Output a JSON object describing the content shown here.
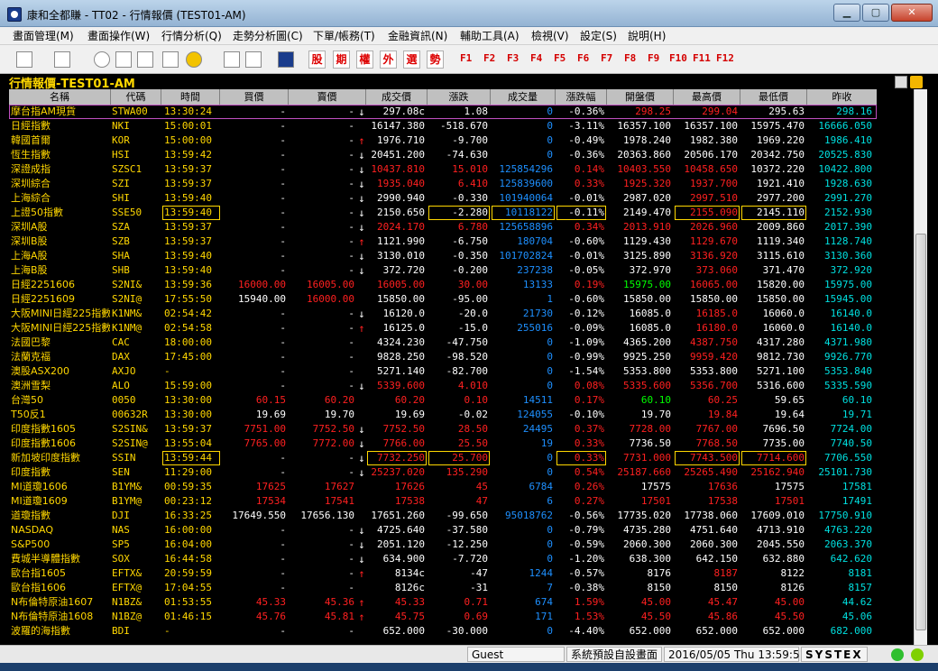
{
  "window": {
    "title": "康和全都賺 - TT02 - 行情報價 (TEST01-AM)"
  },
  "menu": [
    "畫面管理(M)",
    "畫面操作(W)",
    "行情分析(Q)",
    "走勢分析圖(C)",
    "下單/帳務(T)",
    "金融資訊(N)",
    "輔助工具(A)",
    "檢視(V)",
    "設定(S)",
    "說明(H)"
  ],
  "toolbar": {
    "cn_buttons": [
      "股",
      "期",
      "權",
      "外",
      "選",
      "勢"
    ],
    "fkeys": [
      "F1",
      "F2",
      "F3",
      "F4",
      "F5",
      "F6",
      "F7",
      "F8",
      "F9",
      "F10",
      "F11",
      "F12"
    ]
  },
  "panel_title": "行情報價-TEST01-AM",
  "columns": [
    "名稱",
    "代碼",
    "時間",
    "買價",
    "賣價",
    "成交價",
    "漲跌",
    "成交量",
    "漲跌幅",
    "開盤價",
    "最高價",
    "最低價",
    "昨收"
  ],
  "rows": [
    [
      "摩台指AM現貨",
      "STWA00",
      "13:30:24",
      "-",
      "-",
      "↓",
      "297.08c",
      "1.08",
      "0",
      "-0.36%",
      "298.25",
      "299.04",
      "295.63",
      "298.16"
    ],
    [
      "日經指數",
      "NKI",
      "15:00:01",
      "-",
      "-",
      "",
      "16147.380",
      "-518.670",
      "0",
      "-3.11%",
      "16357.100",
      "16357.100",
      "15975.470",
      "16666.050"
    ],
    [
      "韓國首爾",
      "KOR",
      "15:00:00",
      "-",
      "-",
      "↑",
      "1976.710",
      "-9.700",
      "0",
      "-0.49%",
      "1978.240",
      "1982.380",
      "1969.220",
      "1986.410"
    ],
    [
      "恆生指數",
      "HSI",
      "13:59:42",
      "-",
      "-",
      "↓",
      "20451.200",
      "-74.630",
      "0",
      "-0.36%",
      "20363.860",
      "20506.170",
      "20342.750",
      "20525.830"
    ],
    [
      "深證成指",
      "SZSC1",
      "13:59:37",
      "-",
      "-",
      "↓",
      "10437.810",
      "15.010",
      "125854296",
      "0.14%",
      "10403.550",
      "10458.650",
      "10372.220",
      "10422.800"
    ],
    [
      "深圳綜合",
      "SZI",
      "13:59:37",
      "-",
      "-",
      "↓",
      "1935.040",
      "6.410",
      "125839600",
      "0.33%",
      "1925.320",
      "1937.700",
      "1921.410",
      "1928.630"
    ],
    [
      "上海綜合",
      "SHI",
      "13:59:40",
      "-",
      "-",
      "↓",
      "2990.940",
      "-0.330",
      "101940064",
      "-0.01%",
      "2987.020",
      "2997.510",
      "2977.200",
      "2991.270"
    ],
    [
      "上證50指數",
      "SSE50",
      "13:59:40",
      "-",
      "-",
      "↓",
      "2150.650",
      "-2.280",
      "10118122",
      "-0.11%",
      "2149.470",
      "2155.090",
      "2145.110",
      "2152.930"
    ],
    [
      "深圳A股",
      "SZA",
      "13:59:37",
      "-",
      "-",
      "↓",
      "2024.170",
      "6.780",
      "125658896",
      "0.34%",
      "2013.910",
      "2026.960",
      "2009.860",
      "2017.390"
    ],
    [
      "深圳B股",
      "SZB",
      "13:59:37",
      "-",
      "-",
      "↑",
      "1121.990",
      "-6.750",
      "180704",
      "-0.60%",
      "1129.430",
      "1129.670",
      "1119.340",
      "1128.740"
    ],
    [
      "上海A股",
      "SHA",
      "13:59:40",
      "-",
      "-",
      "↓",
      "3130.010",
      "-0.350",
      "101702824",
      "-0.01%",
      "3125.890",
      "3136.920",
      "3115.610",
      "3130.360"
    ],
    [
      "上海B股",
      "SHB",
      "13:59:40",
      "-",
      "-",
      "↓",
      "372.720",
      "-0.200",
      "237238",
      "-0.05%",
      "372.970",
      "373.060",
      "371.470",
      "372.920"
    ],
    [
      "日經2251606",
      "S2NI&",
      "13:59:36",
      "16000.00",
      "16005.00",
      "",
      "16005.00",
      "30.00",
      "13133",
      "0.19%",
      "15975.00",
      "16065.00",
      "15820.00",
      "15975.00"
    ],
    [
      "日經2251609",
      "S2NI@",
      "17:55:50",
      "15940.00",
      "16000.00",
      "",
      "15850.00",
      "-95.00",
      "1",
      "-0.60%",
      "15850.00",
      "15850.00",
      "15850.00",
      "15945.00"
    ],
    [
      "大阪MINI日經225指數",
      "K1NM&",
      "02:54:42",
      "-",
      "-",
      "↓",
      "16120.0",
      "-20.0",
      "21730",
      "-0.12%",
      "16085.0",
      "16185.0",
      "16060.0",
      "16140.0"
    ],
    [
      "大阪MINI日經225指數",
      "K1NM@",
      "02:54:58",
      "-",
      "-",
      "↑",
      "16125.0",
      "-15.0",
      "255016",
      "-0.09%",
      "16085.0",
      "16180.0",
      "16060.0",
      "16140.0"
    ],
    [
      "法國巴黎",
      "CAC",
      "18:00:00",
      "-",
      "-",
      "",
      "4324.230",
      "-47.750",
      "0",
      "-1.09%",
      "4365.200",
      "4387.750",
      "4317.280",
      "4371.980"
    ],
    [
      "法蘭克福",
      "DAX",
      "17:45:00",
      "-",
      "-",
      "",
      "9828.250",
      "-98.520",
      "0",
      "-0.99%",
      "9925.250",
      "9959.420",
      "9812.730",
      "9926.770"
    ],
    [
      "澳股ASX200",
      "AXJO",
      "-",
      "-",
      "-",
      "",
      "5271.140",
      "-82.700",
      "0",
      "-1.54%",
      "5353.800",
      "5353.800",
      "5271.100",
      "5353.840"
    ],
    [
      "澳洲雪梨",
      "ALO",
      "15:59:00",
      "-",
      "-",
      "↓",
      "5339.600",
      "4.010",
      "0",
      "0.08%",
      "5335.600",
      "5356.700",
      "5316.600",
      "5335.590"
    ],
    [
      "台灣50",
      "0050",
      "13:30:00",
      "60.15",
      "60.20",
      "",
      "60.20",
      "0.10",
      "14511",
      "0.17%",
      "60.10",
      "60.25",
      "59.65",
      "60.10"
    ],
    [
      "T50反1",
      "00632R",
      "13:30:00",
      "19.69",
      "19.70",
      "",
      "19.69",
      "-0.02",
      "124055",
      "-0.10%",
      "19.70",
      "19.84",
      "19.64",
      "19.71"
    ],
    [
      "印度指數1605",
      "S2SIN&",
      "13:59:37",
      "7751.00",
      "7752.50",
      "↓",
      "7752.50",
      "28.50",
      "24495",
      "0.37%",
      "7728.00",
      "7767.00",
      "7696.50",
      "7724.00"
    ],
    [
      "印度指數1606",
      "S2SIN@",
      "13:55:04",
      "7765.00",
      "7772.00",
      "↓",
      "7766.00",
      "25.50",
      "19",
      "0.33%",
      "7736.50",
      "7768.50",
      "7735.00",
      "7740.50"
    ],
    [
      "新加坡印度指數",
      "SSIN",
      "13:59:44",
      "-",
      "-",
      "↓",
      "7732.250",
      "25.700",
      "0",
      "0.33%",
      "7731.000",
      "7743.500",
      "7714.600",
      "7706.550"
    ],
    [
      "印度指數",
      "SEN",
      "11:29:00",
      "-",
      "-",
      "↓",
      "25237.020",
      "135.290",
      "0",
      "0.54%",
      "25187.660",
      "25265.490",
      "25162.940",
      "25101.730"
    ],
    [
      "MI道瓊1606",
      "B1YM&",
      "00:59:35",
      "17625",
      "17627",
      "",
      "17626",
      "45",
      "6784",
      "0.26%",
      "17575",
      "17636",
      "17575",
      "17581"
    ],
    [
      "MI道瓊1609",
      "B1YM@",
      "00:23:12",
      "17534",
      "17541",
      "",
      "17538",
      "47",
      "6",
      "0.27%",
      "17501",
      "17538",
      "17501",
      "17491"
    ],
    [
      "道瓊指數",
      "DJI",
      "16:33:25",
      "17649.550",
      "17656.130",
      "",
      "17651.260",
      "-99.650",
      "95018762",
      "-0.56%",
      "17735.020",
      "17738.060",
      "17609.010",
      "17750.910"
    ],
    [
      "NASDAQ",
      "NAS",
      "16:00:00",
      "-",
      "-",
      "↓",
      "4725.640",
      "-37.580",
      "0",
      "-0.79%",
      "4735.280",
      "4751.640",
      "4713.910",
      "4763.220"
    ],
    [
      "S&P500",
      "SP5",
      "16:04:00",
      "-",
      "-",
      "↓",
      "2051.120",
      "-12.250",
      "0",
      "-0.59%",
      "2060.300",
      "2060.300",
      "2045.550",
      "2063.370"
    ],
    [
      "費城半導體指數",
      "SOX",
      "16:44:58",
      "-",
      "-",
      "↓",
      "634.900",
      "-7.720",
      "0",
      "-1.20%",
      "638.300",
      "642.150",
      "632.880",
      "642.620"
    ],
    [
      "歐台指1605",
      "EFTX&",
      "20:59:59",
      "-",
      "-",
      "↑",
      "8134c",
      "-47",
      "1244",
      "-0.57%",
      "8176",
      "8187",
      "8122",
      "8181"
    ],
    [
      "歐台指1606",
      "EFTX@",
      "17:04:55",
      "-",
      "-",
      "",
      "8126c",
      "-31",
      "7",
      "-0.38%",
      "8150",
      "8150",
      "8126",
      "8157"
    ],
    [
      "N布倫特原油1607",
      "N1BZ&",
      "01:53:55",
      "45.33",
      "45.36",
      "↑",
      "45.33",
      "0.71",
      "674",
      "1.59%",
      "45.00",
      "45.47",
      "45.00",
      "44.62"
    ],
    [
      "N布倫特原油1608",
      "N1BZ@",
      "01:46:15",
      "45.76",
      "45.81",
      "↑",
      "45.75",
      "0.69",
      "171",
      "1.53%",
      "45.50",
      "45.86",
      "45.50",
      "45.06"
    ],
    [
      "波羅的海指數",
      "BDI",
      "-",
      "-",
      "-",
      "",
      "652.000",
      "-30.000",
      "0",
      "-4.40%",
      "652.000",
      "652.000",
      "652.000",
      "682.000"
    ]
  ],
  "status": {
    "user": "Guest",
    "layout": "系統預設自設畫面",
    "datetime": "2016/05/05 Thu 13:59:51",
    "brand": "SYSTEX"
  }
}
